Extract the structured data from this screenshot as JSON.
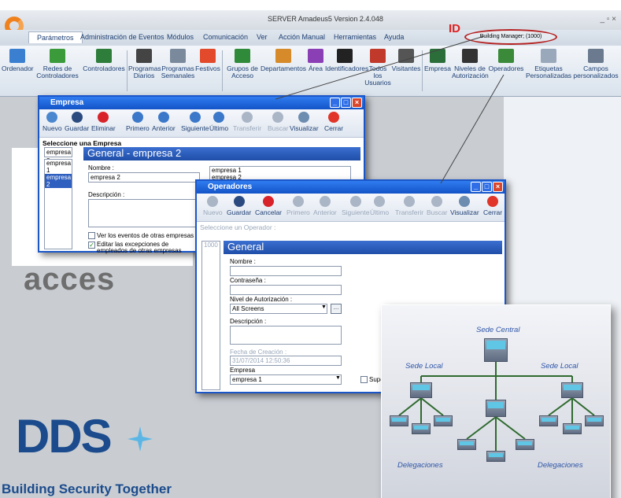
{
  "app": {
    "title": "SERVER Amadeus5 Version 2.4.048",
    "window_controls": "_  ▫  ×",
    "user": "Building Manager; (1000)",
    "id_label": "ID"
  },
  "menu": {
    "active_tab": "Parámetros",
    "items": [
      "Administración de Eventos",
      "Módulos",
      "Comunicación",
      "Ver",
      "Acción Manual",
      "Herramientas",
      "Ayuda"
    ]
  },
  "ribbon": {
    "buttons": [
      {
        "label": "Ordenador"
      },
      {
        "label": "Redes de\nControladores"
      },
      {
        "label": "Controladores"
      },
      {
        "label": "Programas\nDiarios"
      },
      {
        "label": "Programas\nSemanales"
      },
      {
        "label": "Festivos"
      },
      {
        "label": "Grupos de\nAcceso"
      },
      {
        "label": "Departamentos"
      },
      {
        "label": "Área"
      },
      {
        "label": "Identificadores"
      },
      {
        "label": "Todos los\nUsuarios"
      },
      {
        "label": "Visitantes"
      },
      {
        "label": "Empresa"
      },
      {
        "label": "Niveles de\nAutorización"
      },
      {
        "label": "Operadores"
      },
      {
        "label": "Etiquetas\nPersonalizadas"
      },
      {
        "label": "Campos\npersonalizados"
      }
    ]
  },
  "empresa_window": {
    "title": "Empresa",
    "toolbar": [
      "Nuevo",
      "Guardar",
      "Eliminar",
      "Primero",
      "Anterior",
      "Siguiente",
      "Último",
      "Transferir",
      "Buscar",
      "Visualizar",
      "Cerrar"
    ],
    "select_label": "Seleccione una Empresa",
    "list_selected": "empresa 2",
    "list_items": [
      "empresa 1",
      "empresa 2"
    ],
    "header": "General - empresa 2",
    "nombre_label": "Nombre :",
    "nombre_value": "empresa 2",
    "desc_label": "Descripción :",
    "right_list": [
      "empresa 1",
      "empresa 2"
    ],
    "check1": "Ver los eventos de otras empresas",
    "check2": "Editar las excepciones de empleados de otras empresas"
  },
  "operadores_window": {
    "title": "Operadores",
    "toolbar": [
      "Nuevo",
      "Guardar",
      "Cancelar",
      "Primero",
      "Anterior",
      "Siguiente",
      "Último",
      "Transferir",
      "Buscar",
      "Visualizar",
      "Cerrar"
    ],
    "select_label": "Seleccione un Operador :",
    "list_item": "1000",
    "header": "General",
    "nombre_label": "Nombre :",
    "pass_label": "Contraseña :",
    "nivel_label": "Nivel de Autorización :",
    "nivel_value": "All Screens",
    "desc_label": "Descripción :",
    "fecha_label": "Fecha de Creación :",
    "fecha_value": "31/07/2014 12:50:36",
    "empresa_label": "Empresa",
    "empresa_value": "empresa 1",
    "super_label": "Super"
  },
  "diagram": {
    "central": "Sede Central",
    "local_left": "Sede Local",
    "local_right": "Sede Local",
    "deleg_left": "Delegaciones",
    "deleg_right": "Delegaciones"
  },
  "branding": {
    "acceso": "acces",
    "dds": "DDS",
    "tagline": "Building Security Together"
  }
}
